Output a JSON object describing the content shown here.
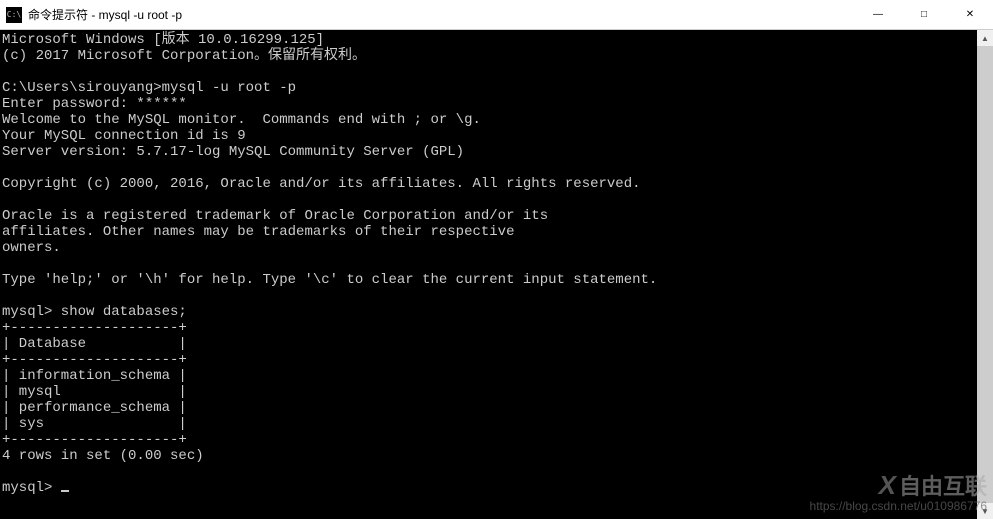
{
  "titlebar": {
    "icon_label": "C:\\",
    "title": "命令提示符 - mysql  -u root -p"
  },
  "window_controls": {
    "minimize": "—",
    "maximize": "□",
    "close": "✕"
  },
  "terminal": {
    "lines": [
      "Microsoft Windows [版本 10.0.16299.125]",
      "(c) 2017 Microsoft Corporation。保留所有权利。",
      "",
      "C:\\Users\\sirouyang>mysql -u root -p",
      "Enter password: ******",
      "Welcome to the MySQL monitor.  Commands end with ; or \\g.",
      "Your MySQL connection id is 9",
      "Server version: 5.7.17-log MySQL Community Server (GPL)",
      "",
      "Copyright (c) 2000, 2016, Oracle and/or its affiliates. All rights reserved.",
      "",
      "Oracle is a registered trademark of Oracle Corporation and/or its",
      "affiliates. Other names may be trademarks of their respective",
      "owners.",
      "",
      "Type 'help;' or '\\h' for help. Type '\\c' to clear the current input statement.",
      "",
      "mysql> show databases;",
      "+--------------------+",
      "| Database           |",
      "+--------------------+",
      "| information_schema |",
      "| mysql              |",
      "| performance_schema |",
      "| sys                |",
      "+--------------------+",
      "4 rows in set (0.00 sec)",
      "",
      "mysql> "
    ]
  },
  "watermark": {
    "logo": "X",
    "brand": "自由互联",
    "url": "https://blog.csdn.net/u010986776"
  }
}
